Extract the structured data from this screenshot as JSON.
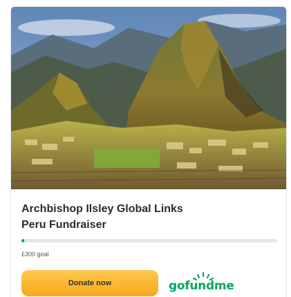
{
  "card": {
    "image_alt": "Machu Picchu mountain landscape",
    "title_line1": "Archbishop Ilsley Global Links",
    "title_line2": "Peru Fundraiser",
    "progress_fraction": 0.01,
    "goal_text": "£300 goal",
    "donate_label": "Donate now",
    "brand": "gofundme"
  },
  "colors": {
    "accent_green": "#02a95c",
    "button_orange": "#f6a91c",
    "title_text": "#2b2b2b"
  },
  "icons": {
    "logo": "gofundme-logo"
  }
}
